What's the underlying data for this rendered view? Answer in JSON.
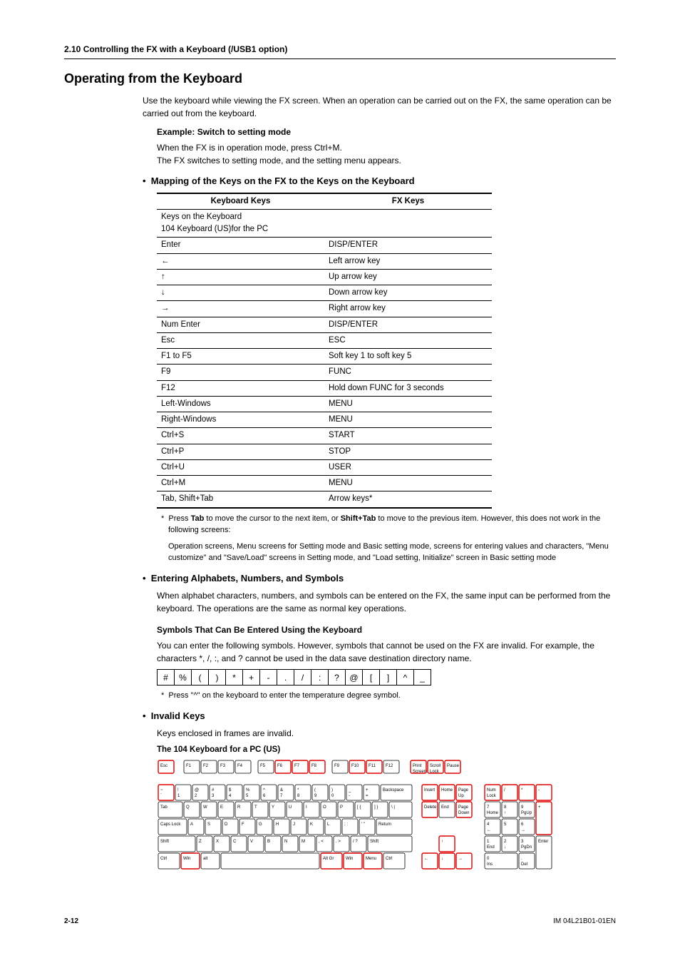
{
  "section_header": "2.10  Controlling the FX with a Keyboard (/USB1 option)",
  "main_heading": "Operating from the Keyboard",
  "intro": "Use the keyboard while viewing the FX screen. When an operation can be carried out on the FX, the same operation can be carried out from the keyboard.",
  "example_heading": "Example: Switch to setting mode",
  "example_line1": "When the FX is in operation mode, press Ctrl+M.",
  "example_line2": "The FX switches to setting mode, and the setting menu appears.",
  "mapping_heading": "Mapping of the Keys on the FX to the Keys on the Keyboard",
  "table": {
    "head_left": "Keyboard Keys",
    "head_right": "FX Keys",
    "row0_left": "Keys on the Keyboard\n104 Keyboard (US)for the PC",
    "row0_right": "",
    "rows": [
      {
        "l": "Enter",
        "r": "DISP/ENTER"
      },
      {
        "l": "←",
        "r": "Left arrow key"
      },
      {
        "l": "↑",
        "r": "Up arrow key"
      },
      {
        "l": "↓",
        "r": "Down arrow key"
      },
      {
        "l": "→",
        "r": "Right arrow key"
      },
      {
        "l": "Num Enter",
        "r": "DISP/ENTER"
      },
      {
        "l": "Esc",
        "r": "ESC"
      },
      {
        "l": "F1 to F5",
        "r": "Soft key 1 to soft key 5"
      },
      {
        "l": "F9",
        "r": "FUNC"
      },
      {
        "l": "F12",
        "r": "Hold down FUNC for 3 seconds"
      },
      {
        "l": "Left-Windows",
        "r": "MENU"
      },
      {
        "l": "Right-Windows",
        "r": "MENU"
      },
      {
        "l": "Ctrl+S",
        "r": "START"
      },
      {
        "l": "Ctrl+P",
        "r": "STOP"
      },
      {
        "l": "Ctrl+U",
        "r": "USER"
      },
      {
        "l": "Ctrl+M",
        "r": "MENU"
      },
      {
        "l": "Tab, Shift+Tab",
        "r": "Arrow keys*"
      }
    ]
  },
  "footnote1_marker": "*",
  "footnote1_text": "Press Tab to move the cursor to the next item, or Shift+Tab to move to the previous item. However, this does not work in the following screens:",
  "footnote1_sub": "Operation screens, Menu screens for Setting mode and Basic setting mode, screens for entering values and characters, \"Menu customize\" and \"Save/Load\" screens in Setting mode, and \"Load setting, Initialize\" screen in Basic setting mode",
  "entering_heading": "Entering Alphabets, Numbers, and Symbols",
  "entering_text": "When alphabet characters, numbers, and symbols can be entered on the FX, the same input can be performed from the keyboard. The operations are the same as normal key operations.",
  "symbols_heading": "Symbols That Can Be Entered Using the Keyboard",
  "symbols_text": "You can enter the following symbols. However, symbols that cannot be used on the FX are invalid. For example, the characters *, /, :, and ? cannot be used in the data save destination directory name.",
  "symbols_list": [
    "#",
    "%",
    "(",
    ")",
    "*",
    "+",
    "-",
    ".",
    "/",
    ":",
    "?",
    "@",
    "[",
    "]",
    "^",
    "_"
  ],
  "symbols_footnote": "Press \"^\" on the keyboard to enter the temperature degree symbol.",
  "invalid_heading": "Invalid Keys",
  "invalid_text": "Keys enclosed in frames are invalid.",
  "kb_title": "The 104 Keyboard for a PC (US)",
  "keyboard": {
    "frow_left": [
      "Esc"
    ],
    "frow_g1": [
      "F1",
      "F2",
      "F3",
      "F4"
    ],
    "frow_g2": [
      "F5",
      "F6",
      "F7",
      "F8"
    ],
    "frow_g3": [
      "F9",
      "F10",
      "F11",
      "F12"
    ],
    "frow_right": [
      "Print\nScreen",
      "Scroll\nLock",
      "Pause"
    ],
    "num_row": [
      [
        "~",
        "`"
      ],
      [
        "!",
        "1"
      ],
      [
        "@",
        "2"
      ],
      [
        "#",
        "3"
      ],
      [
        "$",
        "4"
      ],
      [
        "%",
        "5"
      ],
      [
        "^",
        "6"
      ],
      [
        "&",
        "7"
      ],
      [
        "*",
        "8"
      ],
      [
        "(",
        "9"
      ],
      [
        ")",
        "0"
      ],
      [
        "_",
        "-"
      ],
      [
        "+",
        "="
      ],
      [
        "Backspace",
        ""
      ]
    ],
    "tab_row": [
      "Tab",
      "Q",
      "W",
      "E",
      "R",
      "T",
      "Y",
      "U",
      "I",
      "O",
      "P",
      "[  {",
      "]  }",
      "\\  |"
    ],
    "caps_row": [
      "Caps Lock",
      "A",
      "S",
      "D",
      "F",
      "G",
      "H",
      "J",
      "K",
      "L",
      ";  :",
      "'  \"",
      "Return"
    ],
    "shift_row": [
      "Shift",
      "Z",
      "X",
      "C",
      "V",
      "B",
      "N",
      "M",
      ",  <",
      ".  >",
      "/  ?",
      "Shift"
    ],
    "ctrl_row": [
      "Ctrl",
      "Win",
      "alt",
      "",
      "Alt Gr",
      "Win",
      "Menu",
      "Ctrl"
    ],
    "nav_top": [
      "Insert",
      "Home",
      "Page\nUp"
    ],
    "nav_bot": [
      "Delete",
      "End",
      "Page\nDown"
    ],
    "arrows": [
      "↑",
      "←",
      "↓",
      "→"
    ],
    "numpad": [
      [
        "Num\nLock",
        "/",
        "*",
        "-"
      ],
      [
        "7\nHome",
        "8\n↑",
        "9\nPgUp",
        "+"
      ],
      [
        "4\n←",
        "5",
        "6\n→",
        ""
      ],
      [
        "1\nEnd",
        "2\n↓",
        "3\nPgDn",
        "Enter"
      ],
      [
        "0\nIns",
        "",
        ".\nDel",
        ""
      ]
    ]
  },
  "page_number": "2-12",
  "doc_id": "IM 04L21B01-01EN"
}
